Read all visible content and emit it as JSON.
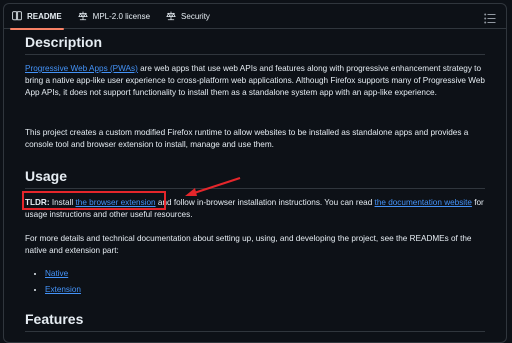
{
  "tabs": [
    {
      "label": "README",
      "icon": "book-icon"
    },
    {
      "label": "MPL-2.0 license",
      "icon": "scale-icon"
    },
    {
      "label": "Security",
      "icon": "scale-icon"
    }
  ],
  "menu_icon": "list-menu-icon",
  "sections": {
    "description": {
      "heading": "Description",
      "p1_link": "Progressive Web Apps (PWAs)",
      "p1_text": " are web apps that use web APIs and features along with progressive enhancement strategy to bring a native app-like user experience to cross-platform web applications. Although Firefox supports many of Progressive Web App APIs, it does not support functionality to install them as a standalone system app with an app-like experience.",
      "p2_text": "This project creates a custom modified Firefox runtime to allow websites to be installed as standalone apps and provides a console tool and browser extension to install, manage and use them."
    },
    "usage": {
      "heading": "Usage",
      "tldr_label": "TLDR:",
      "tldr_text1": " Install ",
      "tldr_link1": "the browser extension",
      "tldr_text2": " and follow in-browser installation instructions. You can read ",
      "tldr_link2": "the documentation website",
      "tldr_text3": " for usage instructions and other useful resources.",
      "p4_text": "For more details and technical documentation about setting up, using, and developing the project, see the READMEs of the native and extension part:",
      "links": [
        "Native",
        "Extension"
      ]
    },
    "features": {
      "heading": "Features"
    }
  },
  "annotation_color": "#e5262b",
  "accent_color": "#f78166",
  "link_color": "#4493f8"
}
